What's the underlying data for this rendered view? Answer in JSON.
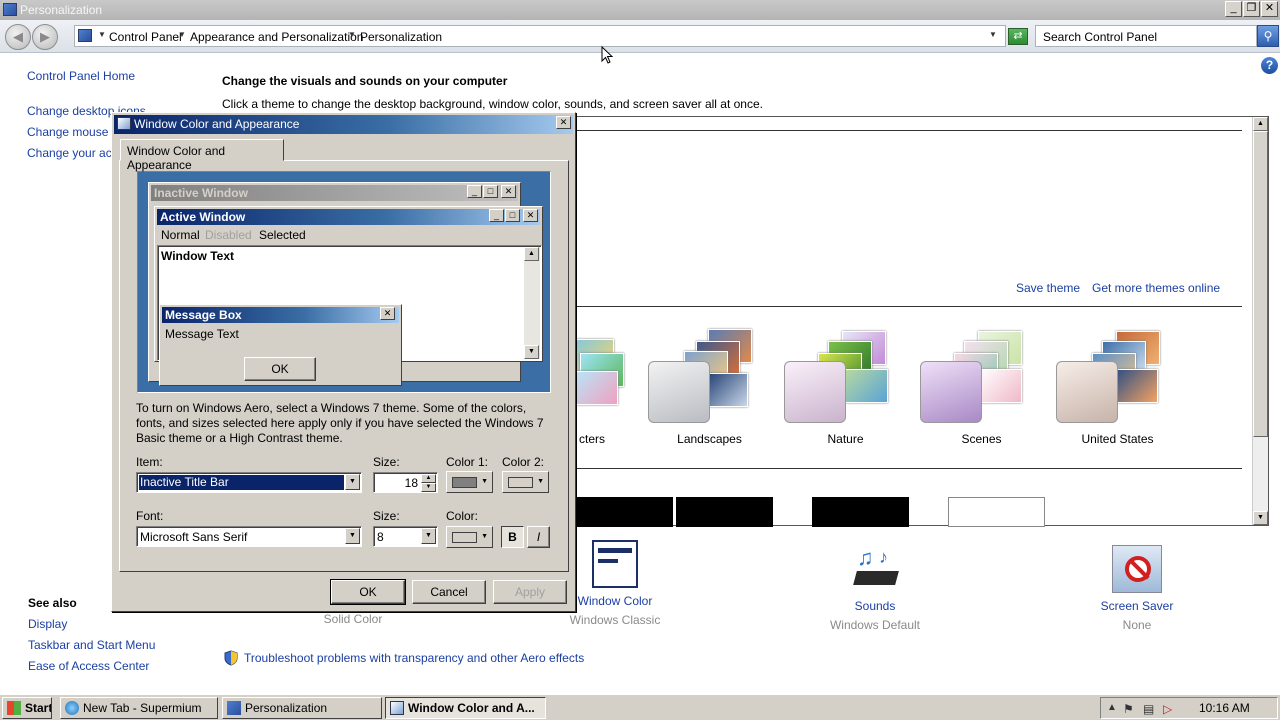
{
  "window": {
    "title": "Personalization"
  },
  "address": {
    "crumbs": [
      "Control Panel",
      "Appearance and Personalization",
      "Personalization"
    ],
    "search_placeholder": "Search Control Panel"
  },
  "left_panel": {
    "home": "Control Panel Home",
    "links": [
      "Change desktop icons",
      "Change mouse pointers",
      "Change your account picture"
    ],
    "see_also_heading": "See also",
    "see_also": [
      "Display",
      "Taskbar and Start Menu",
      "Ease of Access Center"
    ]
  },
  "main": {
    "heading": "Change the visuals and sounds on your computer",
    "subheading": "Click a theme to change the desktop background, window color, sounds, and screen saver all at once.",
    "save_theme": "Save theme",
    "get_more": "Get more themes online",
    "themes": [
      "cters",
      "Landscapes",
      "Nature",
      "Scenes",
      "United States"
    ],
    "troubleshoot": "Troubleshoot problems with transparency and other Aero effects"
  },
  "bottom_items": [
    {
      "label": "Solid Color",
      "sub": ""
    },
    {
      "label": "Window Color",
      "sub": "Windows Classic"
    },
    {
      "label": "Sounds",
      "sub": "Windows Default"
    },
    {
      "label": "Screen Saver",
      "sub": "None"
    }
  ],
  "dialog": {
    "title": "Window Color and Appearance",
    "tab": "Window Color and Appearance",
    "preview": {
      "inactive": "Inactive Window",
      "active": "Active Window",
      "menu": [
        "Normal",
        "Disabled",
        "Selected"
      ],
      "window_text": "Window Text",
      "msgbox_title": "Message Box",
      "msgbox_text": "Message Text",
      "ok": "OK"
    },
    "info": "To turn on Windows Aero, select a Windows 7 theme.  Some of the colors, fonts, and sizes selected here apply only if you have selected the Windows 7 Basic theme or a High Contrast theme.",
    "item_label": "Item:",
    "item_value": "Inactive Title Bar",
    "size_label": "Size:",
    "size_value": "18",
    "color1_label": "Color 1:",
    "color2_label": "Color 2:",
    "font_label": "Font:",
    "font_value": "Microsoft Sans Serif",
    "font_size_label": "Size:",
    "font_size_value": "8",
    "font_color_label": "Color:",
    "bold": "B",
    "italic": "I",
    "ok": "OK",
    "cancel": "Cancel",
    "apply": "Apply"
  },
  "taskbar": {
    "start": "Start",
    "buttons": [
      "New Tab - Supermium",
      "Personalization",
      "Window Color and A..."
    ],
    "clock": "10:16 AM"
  },
  "colors": {
    "link": "#1b3fa3",
    "dialog_face": "#d4d0c8",
    "active_title": "#0a246a",
    "desktop_blue": "#3a6ea5"
  }
}
